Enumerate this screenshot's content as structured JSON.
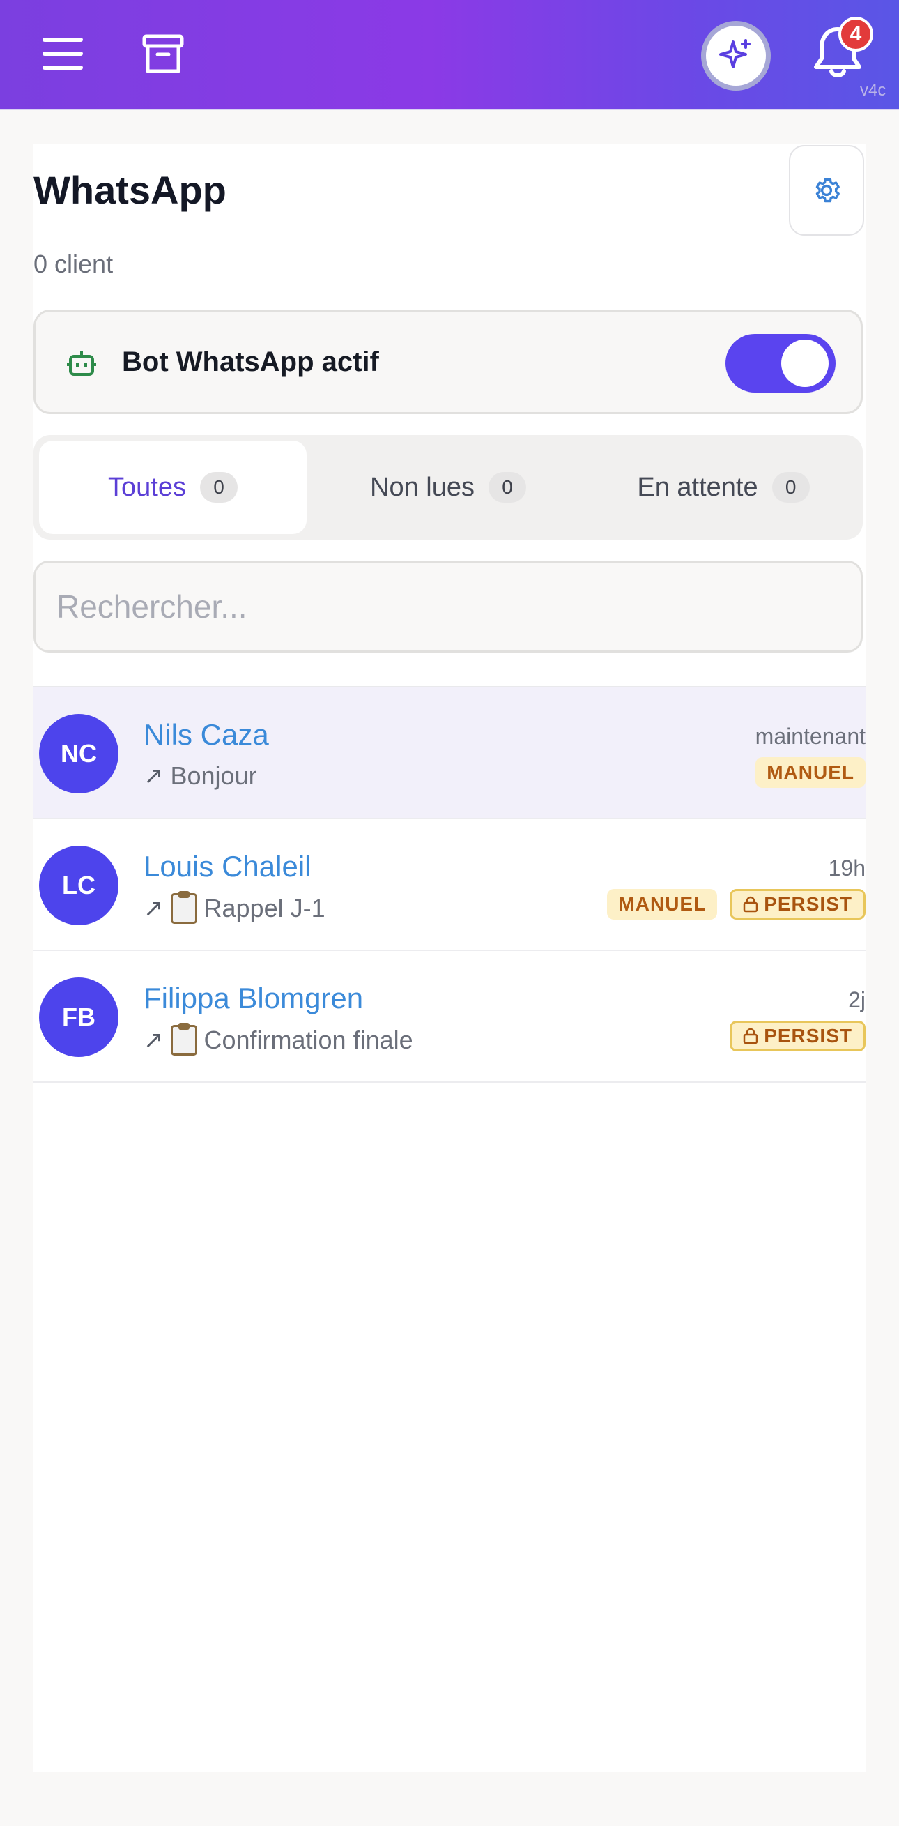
{
  "header": {
    "version": "v4c",
    "notifications_count": "4",
    "icons": {
      "menu": "menu-icon",
      "archive": "archive-icon",
      "ai": "sparkles-icon",
      "bell": "bell-icon"
    }
  },
  "page": {
    "title": "WhatsApp",
    "client_count": "0 client"
  },
  "bot": {
    "label": "Bot WhatsApp actif",
    "enabled": true
  },
  "tabs": [
    {
      "label": "Toutes",
      "count": "0",
      "active": true
    },
    {
      "label": "Non lues",
      "count": "0",
      "active": false
    },
    {
      "label": "En attente",
      "count": "0",
      "active": false
    }
  ],
  "search": {
    "placeholder": "Rechercher...",
    "value": ""
  },
  "conversations": [
    {
      "initials": "NC",
      "name": "Nils Caza",
      "preview": "Bonjour",
      "time": "maintenant",
      "badges": [
        "MANUEL"
      ]
    },
    {
      "initials": "LC",
      "name": "Louis Chaleil",
      "preview": "Rappel J-1",
      "time": "19h",
      "badges": [
        "MANUEL",
        "PERSIST"
      ]
    },
    {
      "initials": "FB",
      "name": "Filippa Blomgren",
      "preview": "Confirmation finale",
      "time": "2j",
      "badges": [
        "PERSIST"
      ]
    }
  ],
  "colors": {
    "accent": "#5a44ef",
    "avatar": "#4d44ec",
    "link": "#3b8ad9",
    "badge_bg": "#fdf0c7",
    "badge_text": "#b05a12"
  }
}
